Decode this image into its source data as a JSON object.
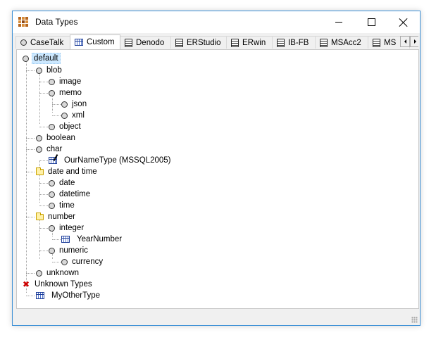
{
  "window": {
    "title": "Data Types"
  },
  "tabs": [
    {
      "label": "CaseTalk",
      "icon": "circle-icon"
    },
    {
      "label": "Custom",
      "icon": "table-icon"
    },
    {
      "label": "Denodo",
      "icon": "database-icon"
    },
    {
      "label": "ERStudio",
      "icon": "database-icon"
    },
    {
      "label": "ERwin",
      "icon": "database-icon"
    },
    {
      "label": "IB-FB",
      "icon": "database-icon"
    },
    {
      "label": "MSAcc2",
      "icon": "database-icon"
    },
    {
      "label": "MS",
      "icon": "database-icon"
    }
  ],
  "tree": [
    {
      "label": "default",
      "icon": "circle"
    },
    {
      "label": "blob",
      "icon": "circle"
    },
    {
      "label": "image",
      "icon": "circle"
    },
    {
      "label": "memo",
      "icon": "circle"
    },
    {
      "label": "json",
      "icon": "circle"
    },
    {
      "label": "xml",
      "icon": "circle"
    },
    {
      "label": "object",
      "icon": "circle"
    },
    {
      "label": "boolean",
      "icon": "circle"
    },
    {
      "label": "char",
      "icon": "circle"
    },
    {
      "label": "OurNameType (MSSQL2005)",
      "icon": "table-edit"
    },
    {
      "label": "date and time",
      "icon": "folder"
    },
    {
      "label": "date",
      "icon": "circle"
    },
    {
      "label": "datetime",
      "icon": "circle"
    },
    {
      "label": "time",
      "icon": "circle"
    },
    {
      "label": "number",
      "icon": "folder"
    },
    {
      "label": "integer",
      "icon": "circle"
    },
    {
      "label": "YearNumber",
      "icon": "table"
    },
    {
      "label": "numeric",
      "icon": "circle"
    },
    {
      "label": "currency",
      "icon": "circle"
    },
    {
      "label": "unknown",
      "icon": "circle"
    },
    {
      "label": "Unknown Types",
      "icon": "red-x"
    },
    {
      "label": "MyOtherType",
      "icon": "table"
    }
  ],
  "colors": {
    "selection": "#cce8ff",
    "accent_border": "#3b8fd6",
    "unknown_x": "#cc0000"
  }
}
